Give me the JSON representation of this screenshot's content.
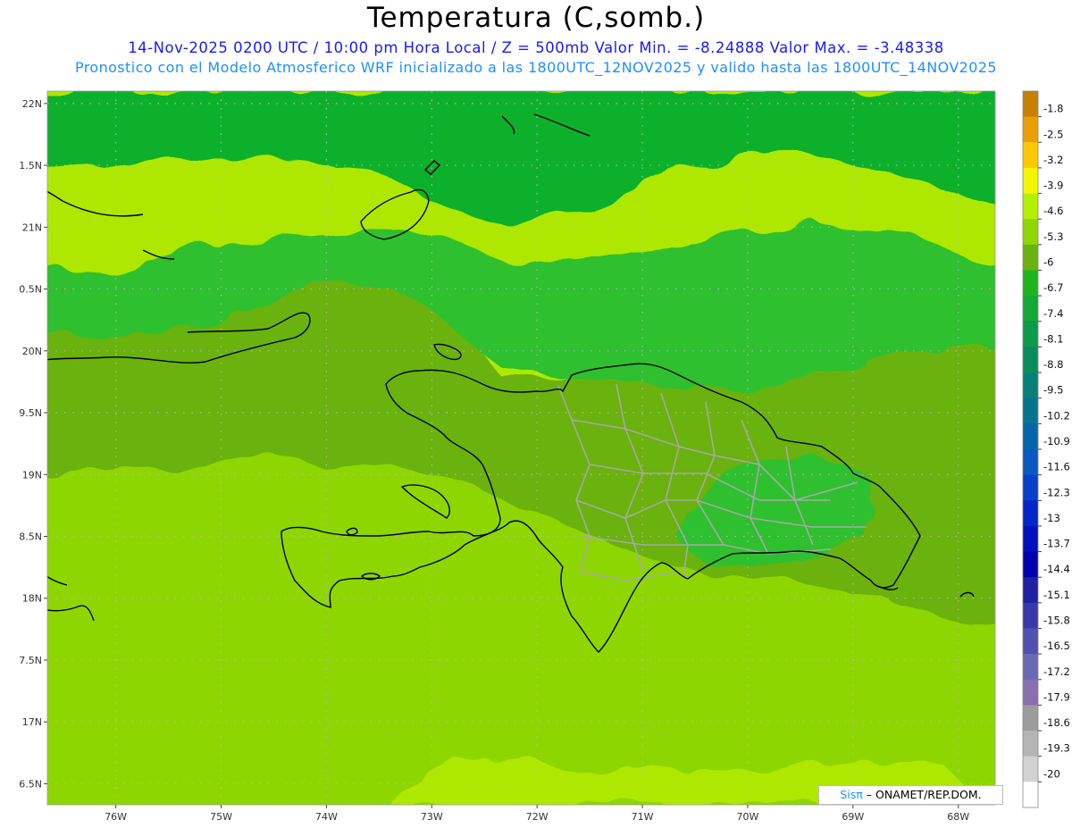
{
  "header": {
    "title": "Temperatura (C,somb.)",
    "subtitle_1": "14-Nov-2025  0200 UTC / 10:00 pm Hora Local / Z = 500mb  Valor Min. = -8.24888  Valor Max. = -3.48338",
    "subtitle_2": "Pronostico con el Modelo Atmosferico WRF inicializado a las 1800UTC_12NOV2025 y valido hasta las  1800UTC_14NOV2025"
  },
  "map": {
    "lon_range": [
      -76.65,
      -67.65
    ],
    "lat_range": [
      16.33,
      22.1
    ],
    "lat_ticks": [
      {
        "value": 22.0,
        "label": "22N"
      },
      {
        "value": 21.5,
        "label": "1.5N"
      },
      {
        "value": 21.0,
        "label": "21N"
      },
      {
        "value": 20.5,
        "label": "0.5N"
      },
      {
        "value": 20.0,
        "label": "20N"
      },
      {
        "value": 19.5,
        "label": "9.5N"
      },
      {
        "value": 19.0,
        "label": "19N"
      },
      {
        "value": 18.5,
        "label": "8.5N"
      },
      {
        "value": 18.0,
        "label": "18N"
      },
      {
        "value": 17.5,
        "label": "7.5N"
      },
      {
        "value": 17.0,
        "label": "17N"
      },
      {
        "value": 16.5,
        "label": "6.5N"
      }
    ],
    "lon_ticks": [
      {
        "value": -76,
        "label": "76W"
      },
      {
        "value": -75,
        "label": "75W"
      },
      {
        "value": -74,
        "label": "74W"
      },
      {
        "value": -73,
        "label": "73W"
      },
      {
        "value": -72,
        "label": "72W"
      },
      {
        "value": -71,
        "label": "71W"
      },
      {
        "value": -70,
        "label": "70W"
      },
      {
        "value": -69,
        "label": "69W"
      },
      {
        "value": -68,
        "label": "68W"
      }
    ],
    "field_colors": {
      "north_dark": "#0cb02c",
      "mid_green": "#2fc02f",
      "olive": "#6ab20e",
      "light_green": "#8ed600",
      "yellow_green": "#aee800"
    },
    "coast_color": "#000000",
    "province_color": "#a8a8a8",
    "grid_color": "#b8b8b8"
  },
  "colorbar": {
    "levels": [
      {
        "label": "-1.8",
        "color": "#c88000"
      },
      {
        "label": "-2.5",
        "color": "#e8a000"
      },
      {
        "label": "-3.2",
        "color": "#ffc800"
      },
      {
        "label": "-3.9",
        "color": "#f5f500"
      },
      {
        "label": "-4.6",
        "color": "#b4f000"
      },
      {
        "label": "-5.3",
        "color": "#8ed600"
      },
      {
        "label": "-6",
        "color": "#6ab20e"
      },
      {
        "label": "-6.7",
        "color": "#1eb41e"
      },
      {
        "label": "-7.4",
        "color": "#14a834"
      },
      {
        "label": "-8.1",
        "color": "#0e9a48"
      },
      {
        "label": "-8.8",
        "color": "#0a8c5c"
      },
      {
        "label": "-9.5",
        "color": "#08807a"
      },
      {
        "label": "-10.2",
        "color": "#06748e"
      },
      {
        "label": "-10.9",
        "color": "#0466a8"
      },
      {
        "label": "-11.6",
        "color": "#0a58c0"
      },
      {
        "label": "-12.3",
        "color": "#0440c8"
      },
      {
        "label": "-13",
        "color": "#0226c8"
      },
      {
        "label": "-13.7",
        "color": "#0010c0"
      },
      {
        "label": "-14.4",
        "color": "#0000b0"
      },
      {
        "label": "-15.1",
        "color": "#2020a0"
      },
      {
        "label": "-15.8",
        "color": "#3838a8"
      },
      {
        "label": "-16.5",
        "color": "#5050b0"
      },
      {
        "label": "-17.2",
        "color": "#6a6ab4"
      },
      {
        "label": "-17.9",
        "color": "#8670b0"
      },
      {
        "label": "-18.6",
        "color": "#9c9c9c"
      },
      {
        "label": "-19.3",
        "color": "#b4b4b4"
      },
      {
        "label": "-20",
        "color": "#d2d2d2"
      },
      {
        "label": "",
        "color": "#ffffff"
      }
    ]
  },
  "credit": {
    "brand": "Sisπ",
    "text": "– ONAMET/REP.DOM."
  }
}
